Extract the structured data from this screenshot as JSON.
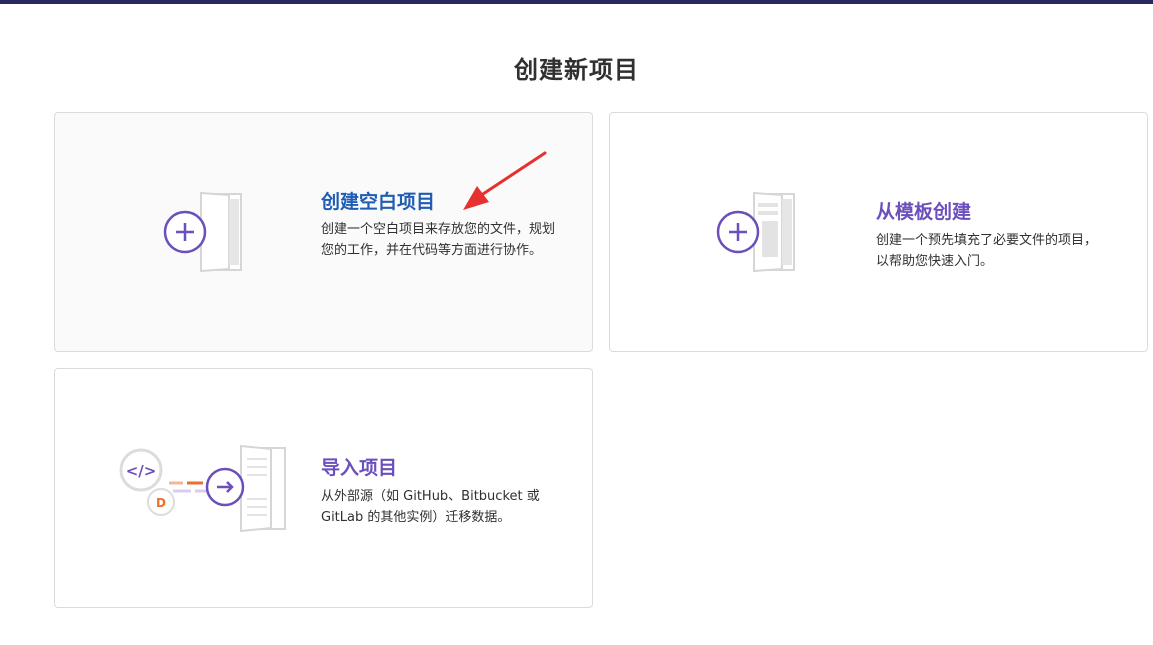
{
  "page": {
    "title": "创建新项目"
  },
  "cards": [
    {
      "title": "创建空白项目",
      "description": "创建一个空白项目来存放您的文件，规划您的工作，并在代码等方面进行协作。",
      "icon": "plus-document-icon"
    },
    {
      "title": "从模板创建",
      "description": "创建一个预先填充了必要文件的项目，以帮助您快速入门。",
      "icon": "template-document-icon"
    },
    {
      "title": "导入项目",
      "description": "从外部源（如 GitHub、Bitbucket 或 GitLab 的其他实例）迁移数据。",
      "icon": "import-document-icon"
    }
  ],
  "colors": {
    "accent": "#6b4fbb",
    "hover_title": "#1f5cb3",
    "top_bar": "#292961",
    "annotation_arrow": "#e5312f",
    "import_orange": "#e9712d"
  }
}
